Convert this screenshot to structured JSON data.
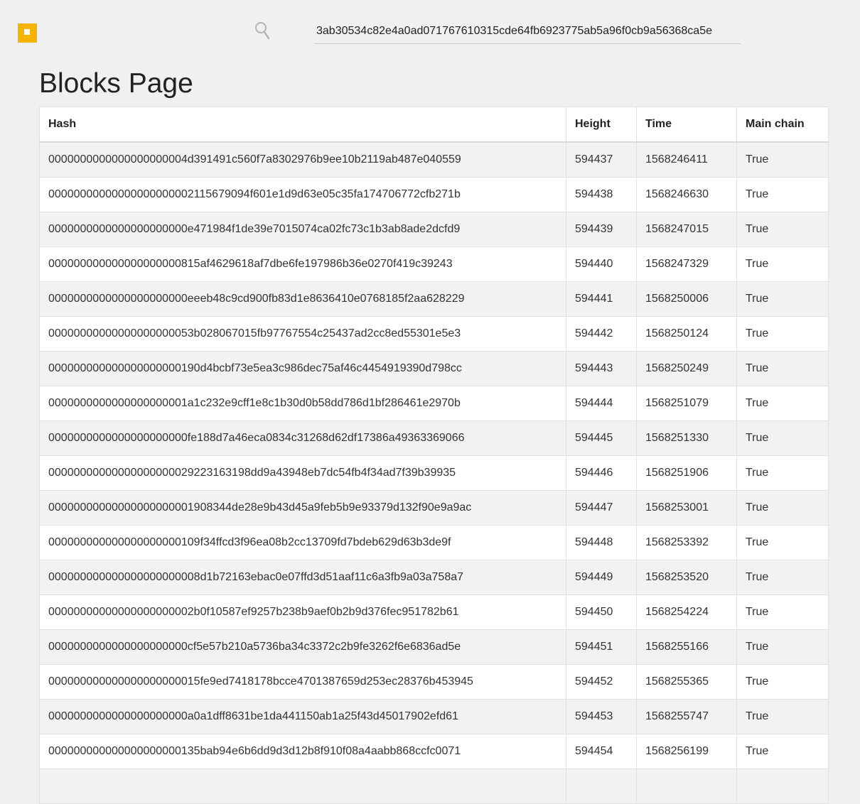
{
  "search": {
    "value": "3ab30534c82e4a0ad071767610315cde64fb6923775ab5a96f0cb9a56368ca5e"
  },
  "page": {
    "title": "Blocks Page"
  },
  "colors": {
    "brand": "#f5b400",
    "background": "#f0f0f0",
    "row_alt": "#f2f2f2"
  },
  "icons": {
    "logo": "logo-icon",
    "search": "search-icon"
  },
  "table": {
    "headers": [
      "Hash",
      "Height",
      "Time",
      "Main chain"
    ],
    "rows": [
      [
        "0000000000000000000004d391491c560f7a8302976b9ee10b2119ab487e040559",
        "594437",
        "1568246411",
        "True"
      ],
      [
        "00000000000000000000002115679094f601e1d9d63e05c35fa174706772cfb271b",
        "594438",
        "1568246630",
        "True"
      ],
      [
        "0000000000000000000000e471984f1de39e7015074ca02fc73c1b3ab8ade2dcfd9",
        "594439",
        "1568247015",
        "True"
      ],
      [
        "000000000000000000000815af4629618af7dbe6fe197986b36e0270f419c39243",
        "594440",
        "1568247329",
        "True"
      ],
      [
        "0000000000000000000000eeeb48c9cd900fb83d1e8636410e0768185f2aa628229",
        "594441",
        "1568250006",
        "True"
      ],
      [
        "00000000000000000000053b028067015fb97767554c25437ad2cc8ed55301e5e3",
        "594442",
        "1568250124",
        "True"
      ],
      [
        "000000000000000000000190d4bcbf73e5ea3c986dec75af46c4454919390d798cc",
        "594443",
        "1568250249",
        "True"
      ],
      [
        "0000000000000000000001a1c232e9cff1e8c1b30d0b58dd786d1bf286461e2970b",
        "594444",
        "1568251079",
        "True"
      ],
      [
        "0000000000000000000000fe188d7a46eca0834c31268d62df17386a49363369066",
        "594445",
        "1568251330",
        "True"
      ],
      [
        "00000000000000000000029223163198dd9a43948eb7dc54fb4f34ad7f39b39935",
        "594446",
        "1568251906",
        "True"
      ],
      [
        "00000000000000000000001908344de28e9b43d45a9feb5b9e93379d132f90e9a9ac",
        "594447",
        "1568253001",
        "True"
      ],
      [
        "000000000000000000000109f34ffcd3f96ea08b2cc13709fd7bdeb629d63b3de9f",
        "594448",
        "1568253392",
        "True"
      ],
      [
        "000000000000000000000008d1b72163ebac0e07ffd3d51aaf11c6a3fb9a03a758a7",
        "594449",
        "1568253520",
        "True"
      ],
      [
        "00000000000000000000002b0f10587ef9257b238b9aef0b2b9d376fec951782b61",
        "594450",
        "1568254224",
        "True"
      ],
      [
        "0000000000000000000000cf5e57b210a5736ba34c3372c2b9fe3262f6e6836ad5e",
        "594451",
        "1568255166",
        "True"
      ],
      [
        "000000000000000000000015fe9ed7418178bcce4701387659d253ec28376b453945",
        "594452",
        "1568255365",
        "True"
      ],
      [
        "0000000000000000000000a0a1dff8631be1da441150ab1a25f43d45017902efd61",
        "594453",
        "1568255747",
        "True"
      ],
      [
        "000000000000000000000135bab94e6b6dd9d3d12b8f910f08a4aabb868ccfc0071",
        "594454",
        "1568256199",
        "True"
      ],
      [
        "",
        "",
        "",
        ""
      ]
    ]
  }
}
